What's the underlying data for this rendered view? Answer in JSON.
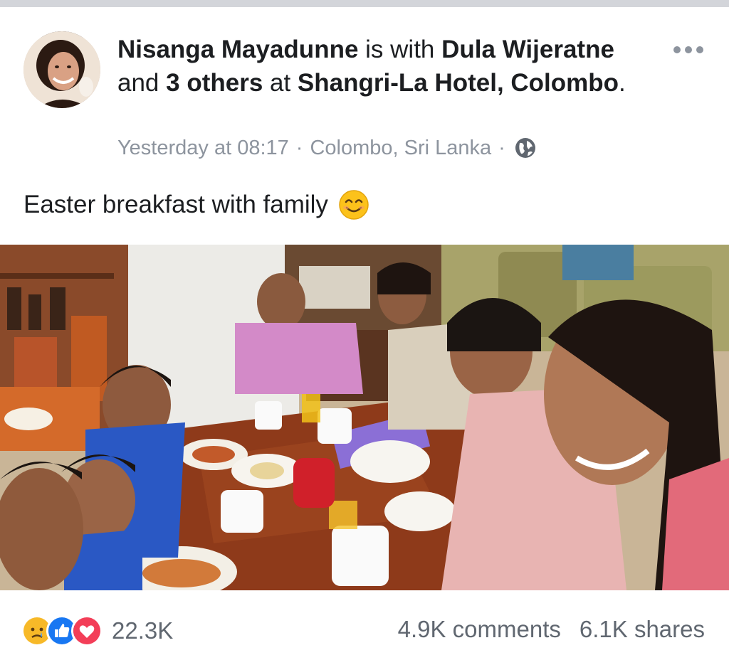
{
  "post": {
    "author": "Nisanga Mayadunne",
    "with_text": " is with ",
    "tagged_person": "Dula Wijeratne",
    "and_text": " and ",
    "others": "3 others",
    "at_text": " at ",
    "place": "Shangri-La Hotel, Colombo",
    "period": ".",
    "timestamp": "Yesterday at 08:17",
    "separator": "·",
    "location": "Colombo, Sri Lanka",
    "privacy_icon": "globe-icon",
    "more_icon": "more-options-icon",
    "text": "Easter breakfast with family",
    "text_emoji": "smiling-face-emoji"
  },
  "engagement": {
    "reaction_icons": [
      "sad-reaction-icon",
      "like-reaction-icon",
      "love-reaction-icon"
    ],
    "reaction_count": "22.3K",
    "comments": "4.9K comments",
    "shares": "6.1K shares"
  },
  "colors": {
    "primary_text": "#1c1e21",
    "secondary_text": "#8d949e",
    "like_blue": "#1877f2",
    "love_red": "#f33e58",
    "sad_yellow": "#f7b928",
    "top_bar": "#d3d5da"
  }
}
